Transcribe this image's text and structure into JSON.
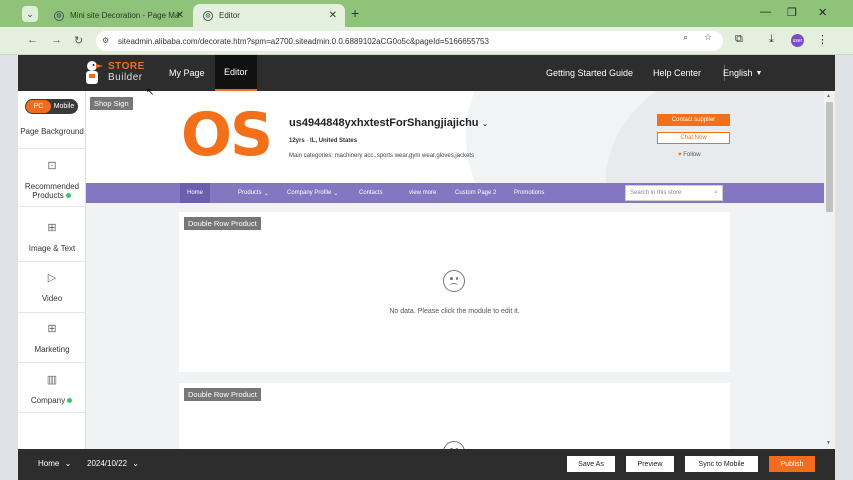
{
  "browser": {
    "tabs": [
      {
        "label": "Mini site Decoration - Page Ma"
      },
      {
        "label": "Editor"
      }
    ],
    "url": "siteadmin.alibaba.com/decorate.htm?spm=a2700.siteadmin.0.0.6889102aCG0o5c&pageId=5166655753",
    "avatar_text": "user"
  },
  "header": {
    "logo_line1": "STORE",
    "logo_line2": "Builder",
    "nav": [
      "My Page",
      "Editor"
    ],
    "right_links": [
      "Getting Started Guide",
      "Help Center"
    ],
    "language": "English"
  },
  "left_panel": {
    "toggle_pc": "PC",
    "toggle_mobile": "Mobile",
    "page_background": "Page Background",
    "items": [
      {
        "label": "Recommended Products",
        "icon": "recommend-icon",
        "dot": true
      },
      {
        "label": "Image & Text",
        "icon": "image-text-icon",
        "dot": false
      },
      {
        "label": "Video",
        "icon": "video-icon",
        "dot": false
      },
      {
        "label": "Marketing",
        "icon": "marketing-icon",
        "dot": false
      },
      {
        "label": "Company",
        "icon": "company-icon",
        "dot": true
      }
    ]
  },
  "store": {
    "shop_sign": "Shop Sign",
    "logo": "OS",
    "name": "us4944848yxhxtestForShangjiajichu",
    "years": "12yrs",
    "location": "IL, United States",
    "main_categories": "Main categories: machinery acc.,sports wear,gym wear,gloves,jackets",
    "contact_btn": "Contact supplier",
    "chat_btn": "Chat Now",
    "follow_btn": "Follow",
    "nav": [
      {
        "label": "Home",
        "dropdown": false
      },
      {
        "label": "Products",
        "dropdown": true
      },
      {
        "label": "Company Profile",
        "dropdown": true
      },
      {
        "label": "Contacts",
        "dropdown": false
      },
      {
        "label": "view more",
        "dropdown": false
      },
      {
        "label": "Custom Page 2",
        "dropdown": false
      },
      {
        "label": "Promotions",
        "dropdown": false
      }
    ],
    "search_placeholder": "Search in this store"
  },
  "modules": [
    {
      "label": "Double Row Product",
      "empty_text": "No data. Please click the module to edit it."
    },
    {
      "label": "Double Row Product",
      "empty_text": ""
    }
  ],
  "bottom": {
    "page": "Home",
    "date": "2024/10/22",
    "save_as": "Save As",
    "preview": "Preview",
    "sync": "Sync to Mobile",
    "publish": "Publish"
  }
}
